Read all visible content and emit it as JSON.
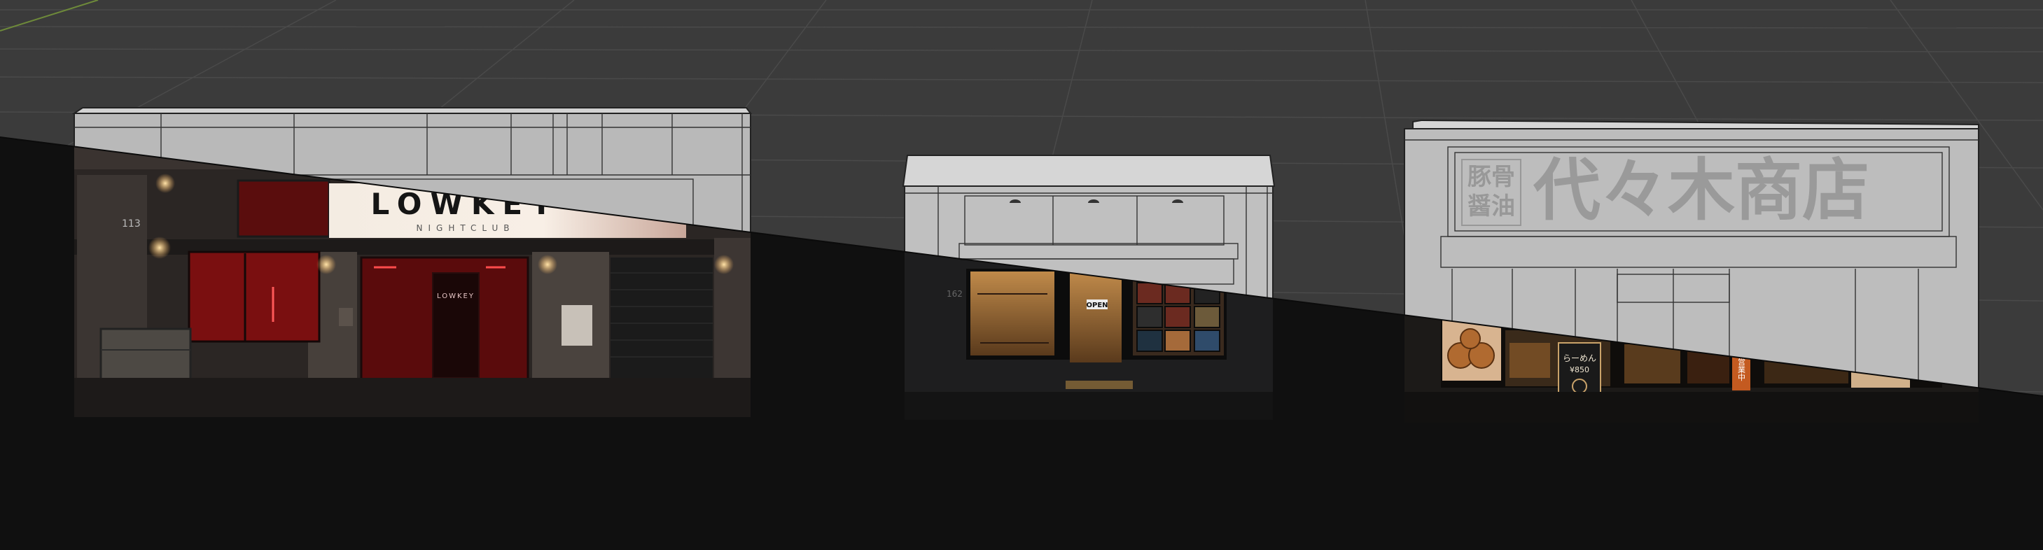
{
  "viewport": {
    "background": "#3a3a3a",
    "render_overlay_color": "#101010"
  },
  "storefronts": [
    {
      "id": "nightclub",
      "sign_main": "LOWKEY",
      "sign_sub": "NIGHTCLUB",
      "door_sign": "LOWKEY",
      "street_number": "113"
    },
    {
      "id": "clothing-shop",
      "window_sign": "OPEN",
      "street_number": "162"
    },
    {
      "id": "ramen-shop",
      "sign_main": "代々木商店",
      "sign_left_line1": "豚骨",
      "sign_left_line2": "醤油",
      "menu_board_line1": "らーめん",
      "menu_board_line2": "¥850",
      "noren_sign": "営業中"
    }
  ]
}
